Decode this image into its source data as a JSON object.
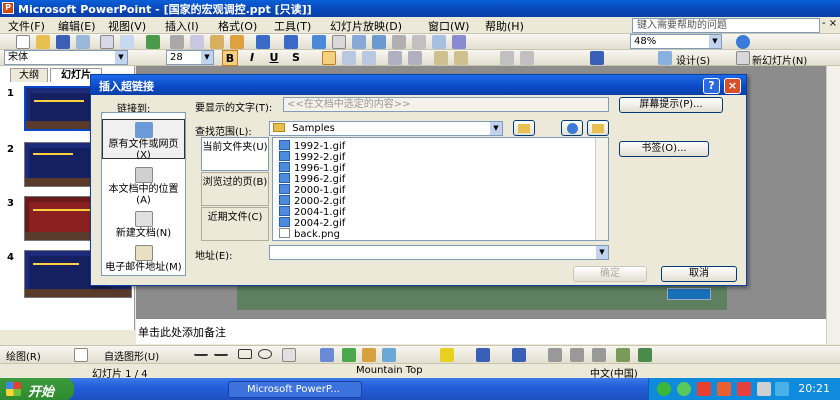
{
  "window": {
    "title": "Microsoft PowerPoint - [国家的宏观调控.ppt [只读]]"
  },
  "menubar": {
    "items": [
      "文件(F)",
      "编辑(E)",
      "视图(V)",
      "插入(I)",
      "格式(O)",
      "工具(T)",
      "幻灯片放映(D)",
      "窗口(W)",
      "帮助(H)"
    ],
    "help_placeholder": "键入需要帮助的问题",
    "window_controls": "- ×"
  },
  "toolbar": {
    "zoom": "48%",
    "font_name": "宋体",
    "font_size": "28",
    "bold": "B",
    "italic": "I",
    "underline": "U",
    "shadow": "S",
    "design_label": "设计(S)",
    "new_slide_label": "新幻灯片(N)"
  },
  "leftpane": {
    "tabs": [
      "大纲",
      "幻灯片"
    ],
    "slide_numbers": [
      "1",
      "2",
      "3",
      "4"
    ]
  },
  "notes": {
    "placeholder": "单击此处添加备注"
  },
  "drawbar": {
    "draw_label": "绘图(R)",
    "autoshape_label": "自选图形(U)"
  },
  "statusbar": {
    "slide_info": "幻灯片 1 / 4",
    "design_name": "Mountain Top",
    "language": "中文(中国)"
  },
  "taskbar": {
    "start_label": "开始",
    "app_button": "Microsoft PowerP...",
    "clock": "20:21"
  },
  "dialog": {
    "title": "插入超链接",
    "help_button": "?",
    "close_button": "×",
    "link_to_label": "链接到:",
    "link_options": [
      "原有文件或网页(X)",
      "本文档中的位置(A)",
      "新建文档(N)",
      "电子邮件地址(M)"
    ],
    "display_text_label": "要显示的文字(T):",
    "display_text_placeholder": "<<在文档中选定的内容>>",
    "screentip_button": "屏幕提示(P)...",
    "lookin_label": "查找范围(L):",
    "lookin_value": "Samples",
    "bookmark_button": "书签(O)...",
    "nav_options": [
      "当前文件夹(U)",
      "浏览过的页(B)",
      "近期文件(C)"
    ],
    "files": [
      "1992-1.gif",
      "1992-2.gif",
      "1996-1.gif",
      "1996-2.gif",
      "2000-1.gif",
      "2000-2.gif",
      "2004-1.gif",
      "2004-2.gif",
      "back.png"
    ],
    "address_label": "地址(E):",
    "address_value": "",
    "ok_button": "确定",
    "cancel_button": "取消"
  }
}
